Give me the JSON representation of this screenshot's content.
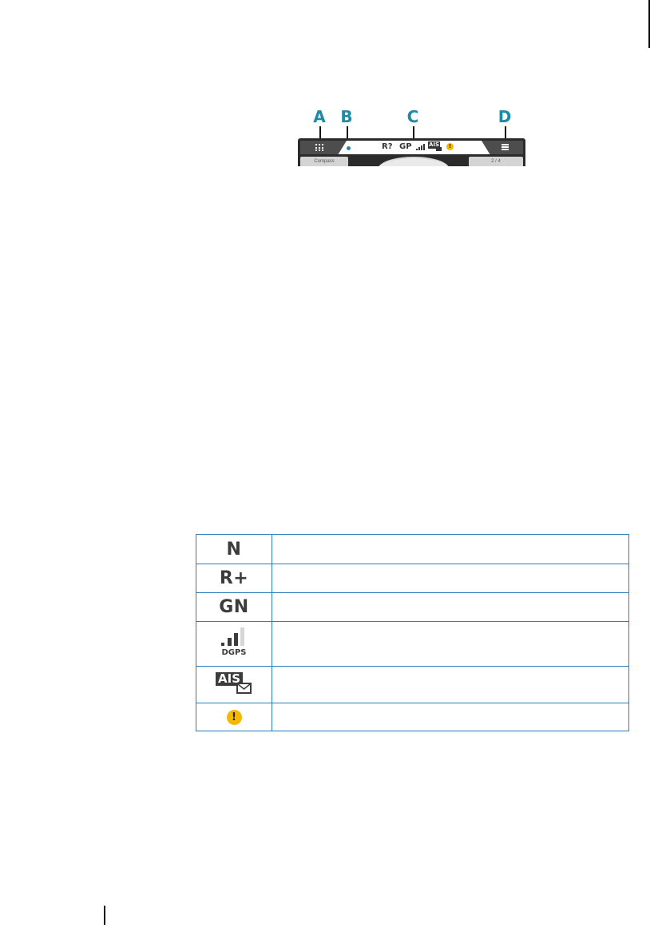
{
  "figure": {
    "callouts": [
      "A",
      "B",
      "C",
      "D"
    ],
    "status_bar": {
      "radar_status": "R?",
      "gps_status": "GP",
      "signal_label": "DGPS",
      "ais_label": "AIS",
      "warning_symbol": "!"
    },
    "tiles": {
      "left": "Compass",
      "right": "2 / 4"
    }
  },
  "legend": {
    "rows": [
      {
        "icon": "N"
      },
      {
        "icon": "R+"
      },
      {
        "icon": "GN"
      },
      {
        "icon": "DGPS"
      },
      {
        "icon": "AIS"
      },
      {
        "icon": "!"
      }
    ]
  },
  "colors": {
    "callout": "#1f8aa5",
    "table_border": "#2b7dbb",
    "warning": "#f5b800",
    "bar": "#4d4d4d"
  }
}
